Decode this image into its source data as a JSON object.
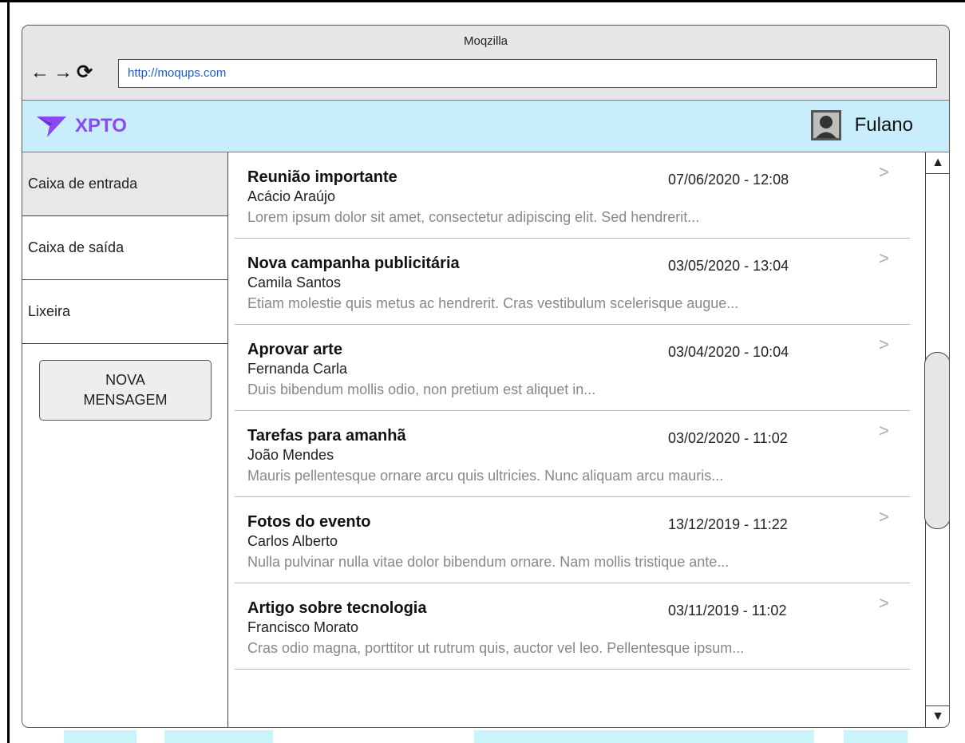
{
  "browser": {
    "window_title": "Moqzilla",
    "url": "http://moqups.com",
    "nav_icons": [
      "back-arrow-icon",
      "forward-arrow-icon",
      "reload-icon"
    ]
  },
  "appbar": {
    "logo_text": "XPTO",
    "logo_icon": "paper-plane-icon",
    "user_name": "Fulano",
    "avatar_icon": "user-avatar-icon",
    "colors": {
      "background": "#c9edfb",
      "logo": "#8a4af3"
    }
  },
  "sidebar": {
    "items": [
      {
        "label": "Caixa de entrada",
        "active": true
      },
      {
        "label": "Caixa de saída",
        "active": false
      },
      {
        "label": "Lixeira",
        "active": false
      }
    ],
    "new_message_button": "NOVA\nMENSAGEM"
  },
  "messages": [
    {
      "subject": "Reunião importante",
      "date": "07/06/2020 - 12:08",
      "sender": "Acácio Araújo",
      "preview": "Lorem ipsum dolor sit amet, consectetur adipiscing elit. Sed hendrerit..."
    },
    {
      "subject": "Nova campanha publicitária",
      "date": "03/05/2020 - 13:04",
      "sender": "Camila Santos",
      "preview": "Etiam molestie quis metus ac hendrerit. Cras vestibulum scelerisque augue..."
    },
    {
      "subject": "Aprovar arte",
      "date": "03/04/2020 - 10:04",
      "sender": "Fernanda Carla",
      "preview": "Duis bibendum mollis odio, non pretium est aliquet in..."
    },
    {
      "subject": "Tarefas para amanhã",
      "date": "03/02/2020 - 11:02",
      "sender": "João Mendes",
      "preview": "Mauris pellentesque ornare arcu quis ultricies. Nunc aliquam arcu mauris..."
    },
    {
      "subject": "Fotos do evento",
      "date": "13/12/2019 - 11:22",
      "sender": "Carlos Alberto",
      "preview": "Nulla pulvinar nulla vitae dolor bibendum ornare. Nam mollis tristique ante..."
    },
    {
      "subject": "Artigo sobre tecnologia",
      "date": "03/11/2019 - 11:02",
      "sender": "Francisco Morato",
      "preview": "Cras odio magna, porttitor ut rutrum quis, auctor vel leo. Pellentesque ipsum..."
    }
  ],
  "message_chevron": ">",
  "scrollbar": {
    "up_arrow": "▲",
    "down_arrow": "▼"
  }
}
